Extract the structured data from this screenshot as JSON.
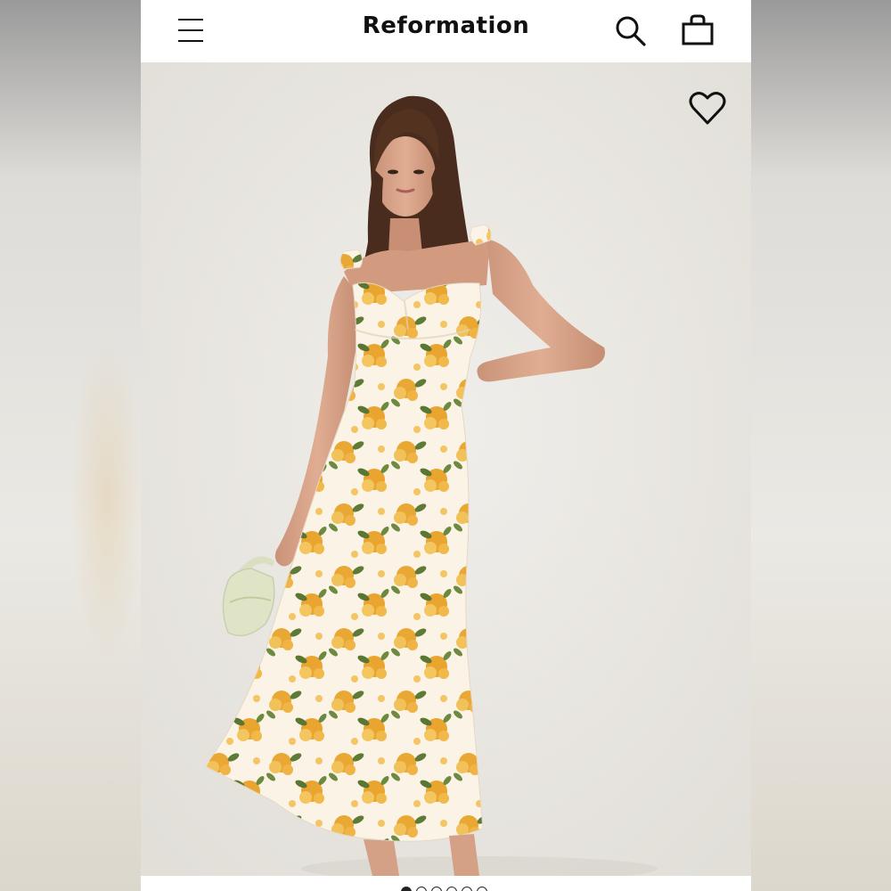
{
  "header": {
    "brand": "Reformation",
    "menu_icon": "hamburger-menu-icon",
    "search_icon": "search-icon",
    "bag_icon": "shopping-bag-icon"
  },
  "product_image": {
    "description_icon": "product-photo",
    "favorite_icon": "heart-icon",
    "dress_colors": [
      "#fbf3e6",
      "#e9a734",
      "#f2c25a",
      "#5d7a36"
    ]
  },
  "carousel": {
    "total": 6,
    "active_index": 0
  }
}
